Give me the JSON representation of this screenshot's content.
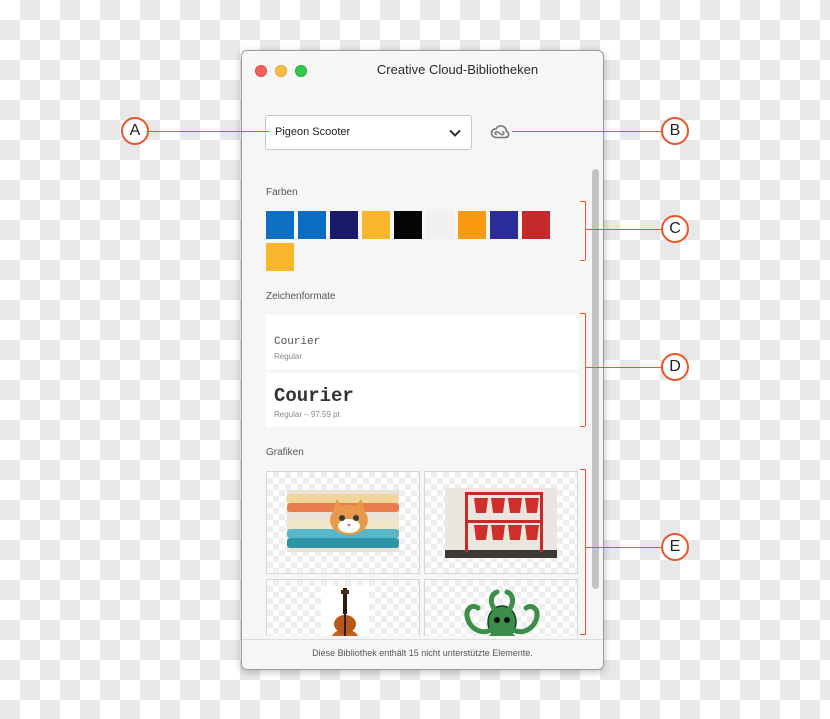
{
  "window": {
    "title": "Creative Cloud-Bibliotheken"
  },
  "library_select": {
    "selected": "Pigeon Scooter",
    "icon": "chevron-down-icon"
  },
  "sync_icon": "creative-cloud-icon",
  "sections": {
    "colors_label": "Farben",
    "char_styles_label": "Zeichenformate",
    "graphics_label": "Grafiken"
  },
  "colors": [
    "#0f6fc2",
    "#0a6dc4",
    "#1a1a6b",
    "#fbb52e",
    "#050505",
    "#f0f0f0",
    "#f99a12",
    "#2d2d9a",
    "#c6292b",
    "#fbb52e"
  ],
  "char_styles": [
    {
      "name": "Courier",
      "meta": "Regular"
    },
    {
      "name": "Courier",
      "meta": "Regular – 97.59 pt"
    }
  ],
  "graphics": [
    {
      "name": "kitten-on-towels"
    },
    {
      "name": "red-fire-buckets"
    },
    {
      "name": "violin"
    },
    {
      "name": "octopus-illustration"
    }
  ],
  "footer": {
    "text": "Diese Bibliothek enthält 15 nicht unterstützte Elemente."
  },
  "callouts": [
    "A",
    "B",
    "C",
    "D",
    "E"
  ],
  "accent_color": "#e8572a"
}
